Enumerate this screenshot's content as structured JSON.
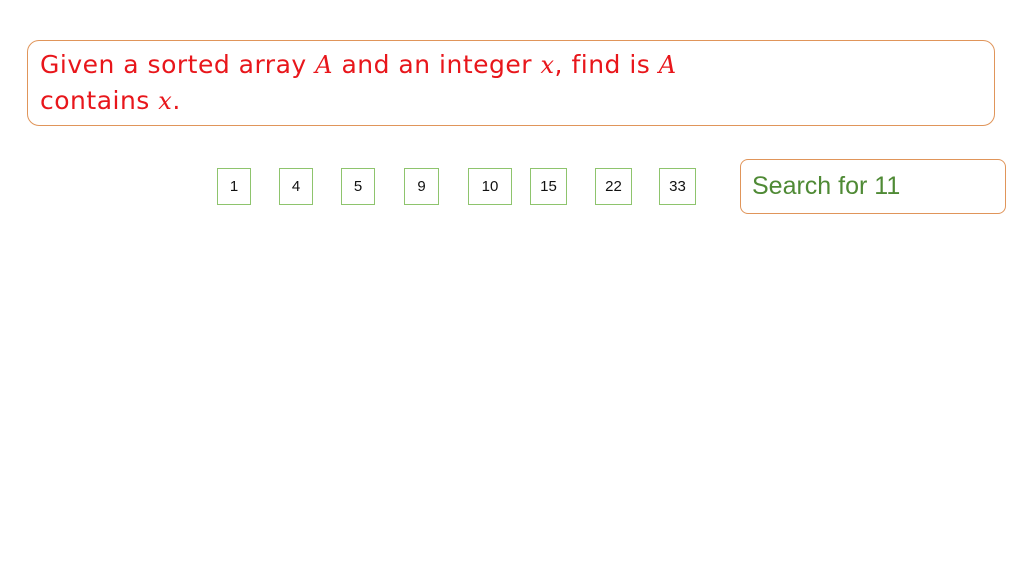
{
  "problem": {
    "line1_parts": [
      "Given a sorted array ",
      "A",
      " and an integer ",
      "x",
      ", find is ",
      "A"
    ],
    "line2_parts": [
      "contains ",
      "x",
      "."
    ]
  },
  "array": {
    "values": [
      "1",
      "4",
      "5",
      "9",
      "10",
      "15",
      "22",
      "33"
    ]
  },
  "search": {
    "label": "Search for 11"
  },
  "colors": {
    "problem_text": "#e8161b",
    "box_border": "#e0955a",
    "cell_border": "#8ec46d",
    "search_text": "#4f8a35"
  }
}
